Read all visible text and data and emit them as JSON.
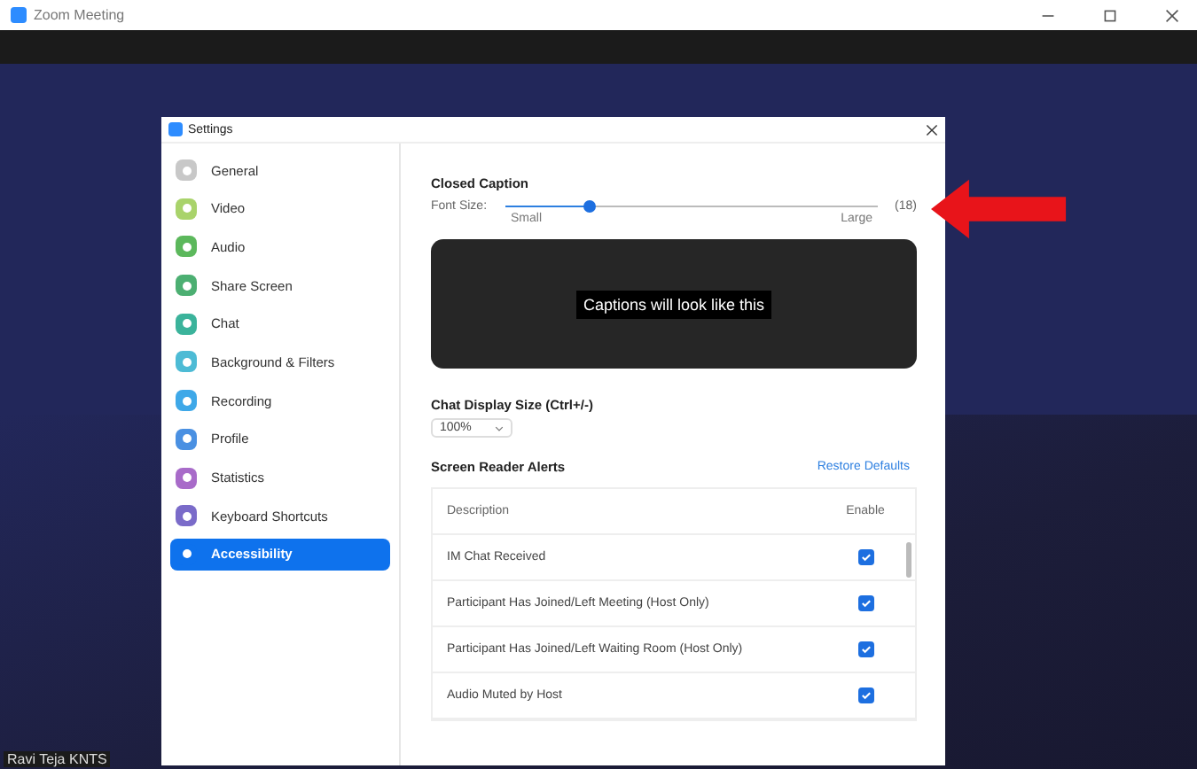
{
  "window": {
    "title": "Zoom Meeting"
  },
  "participant_name": "Ravi Teja KNTS",
  "dialog": {
    "title": "Settings"
  },
  "sidebar": {
    "items": [
      {
        "label": "General",
        "selected": false,
        "color": "#c8c8c8"
      },
      {
        "label": "Video",
        "selected": false,
        "color": "#a9d36b"
      },
      {
        "label": "Audio",
        "selected": false,
        "color": "#5cb85c"
      },
      {
        "label": "Share Screen",
        "selected": false,
        "color": "#4caf72"
      },
      {
        "label": "Chat",
        "selected": false,
        "color": "#3bb39b"
      },
      {
        "label": "Background & Filters",
        "selected": false,
        "color": "#4dbbd5"
      },
      {
        "label": "Recording",
        "selected": false,
        "color": "#3ea8e8"
      },
      {
        "label": "Profile",
        "selected": false,
        "color": "#4a90e2"
      },
      {
        "label": "Statistics",
        "selected": false,
        "color": "#a86bc9"
      },
      {
        "label": "Keyboard Shortcuts",
        "selected": false,
        "color": "#7a6bc9"
      },
      {
        "label": "Accessibility",
        "selected": true,
        "color": "#0e72ed"
      }
    ]
  },
  "closed_caption": {
    "heading": "Closed Caption",
    "font_size_label": "Font Size:",
    "slider": {
      "level": 0.23,
      "min_label": "Small",
      "max_label": "Large"
    },
    "reading": "(18)",
    "preview_text": "Captions will look like this"
  },
  "chat_display": {
    "heading": "Chat Display Size (Ctrl+/-)",
    "value": "100%"
  },
  "screen_reader": {
    "heading": "Screen Reader Alerts",
    "restore_link": "Restore Defaults",
    "columns": [
      "Description",
      "Enable"
    ],
    "rows": [
      {
        "description": "IM Chat Received",
        "checked": true
      },
      {
        "description": "Participant Has Joined/Left Meeting (Host Only)",
        "checked": true
      },
      {
        "description": "Participant Has Joined/Left Waiting Room (Host Only)",
        "checked": true
      },
      {
        "description": "Audio Muted by Host",
        "checked": true
      }
    ]
  }
}
